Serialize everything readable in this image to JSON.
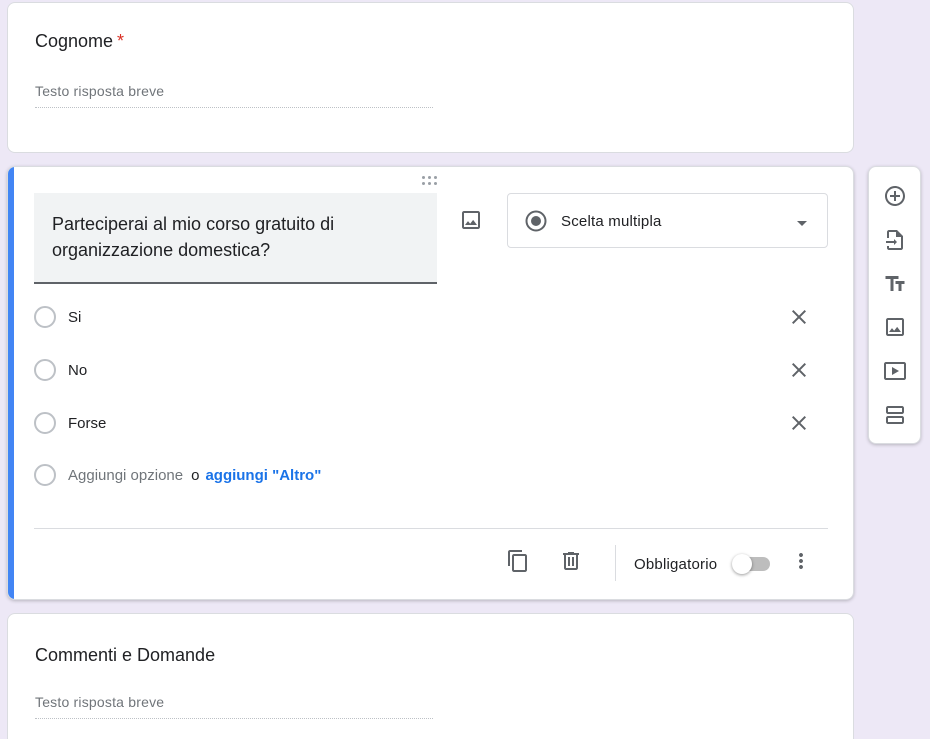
{
  "cards": {
    "cognome": {
      "title": "Cognome",
      "required_mark": "*",
      "placeholder": "Testo risposta breve"
    },
    "question": {
      "text": "Parteciperai al mio corso gratuito di organizzazione domestica?",
      "type": "Scelta multipla",
      "options": [
        "Si",
        "No",
        "Forse"
      ],
      "add_option": "Aggiungi opzione",
      "add_or": "o",
      "add_other": "aggiungi \"Altro\"",
      "required_label": "Obbligatorio",
      "required": false
    },
    "commenti": {
      "title": "Commenti e Domande",
      "placeholder": "Testo risposta breve"
    }
  },
  "icons": {
    "image": "image-icon",
    "type_radio": "radio-checked-icon",
    "dropdown": "arrow-drop-down-icon",
    "remove": "close-icon",
    "duplicate": "copy-icon",
    "delete": "trash-icon",
    "more": "more-vert-icon",
    "toolbar": [
      "add-circle-icon",
      "import-icon",
      "title-icon",
      "image-icon",
      "video-icon",
      "section-icon"
    ]
  },
  "colors": {
    "background": "#ede8f6",
    "accent": "#4285f4",
    "link": "#1a73e8",
    "required": "#d93025"
  }
}
